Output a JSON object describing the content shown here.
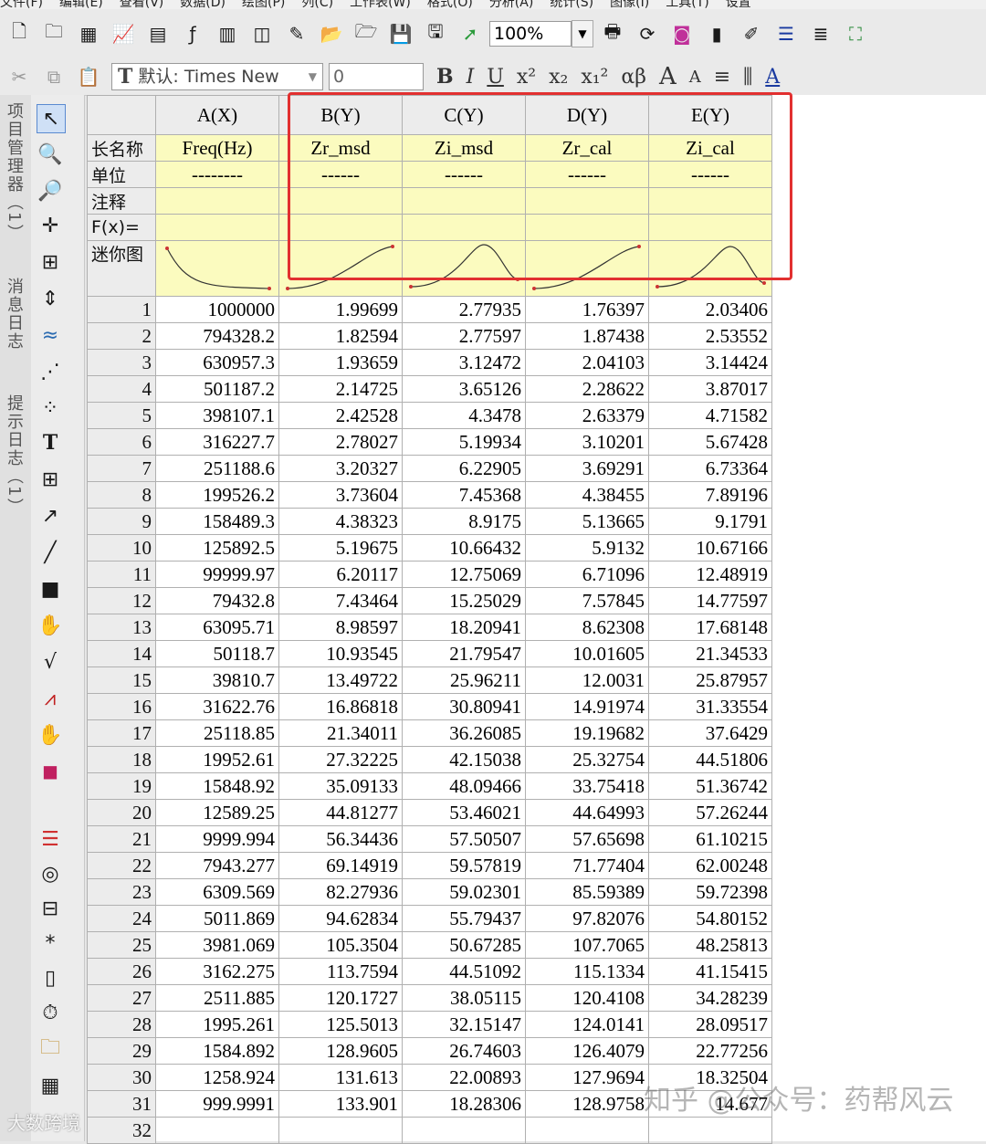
{
  "menu": [
    "文件(F)",
    "编辑(E)",
    "查看(V)",
    "数据(D)",
    "绘图(P)",
    "列(C)",
    "工作表(W)",
    "格式(O)",
    "分析(A)",
    "统计(S)",
    "图像(I)",
    "工具(T)",
    "设置"
  ],
  "toolbar1": {
    "zoom": "100%",
    "icons": [
      "new-project-icon",
      "new-folder-icon",
      "new-workbook-icon",
      "new-graph-icon",
      "new-matrix-icon",
      "new-function-icon",
      "new-excel-icon",
      "new-layout-icon",
      "new-notes-icon",
      "open-icon",
      "open-template-icon",
      "save-icon",
      "save-template-icon",
      "import-wizard-icon",
      "print-icon",
      "refresh-icon",
      "code-builder-icon",
      "film-icon",
      "notes-icon",
      "results-icon",
      "layers-icon",
      "project-explorer-icon"
    ]
  },
  "toolbar2": {
    "font_name": "默认: Times New",
    "font_size": "0",
    "bold": "B",
    "italic": "I",
    "underline": "U",
    "superscript": "x²",
    "subscript": "x₂",
    "supsub": "x₁²",
    "greek": "αβ",
    "bigger": "A",
    "smaller": "A"
  },
  "side_tabs": [
    "项目管理器（1）",
    "消息日志",
    "提示日志（1）"
  ],
  "tools": [
    "pointer-icon",
    "zoom-in-icon",
    "zoom-out-icon",
    "data-reader-icon",
    "screen-reader-icon",
    "scale-icon",
    "data-selector-icon",
    "region-selector-icon",
    "scatter-icon",
    "text-tool-icon",
    "layer-icon",
    "arrow-tool-icon",
    "line-tool-icon",
    "rect-tool-icon",
    "hand-icon",
    "equation-icon",
    "graph-icon",
    "mask-icon",
    "color-icon",
    "color-bars-icon",
    "circle-icon",
    "align-icon",
    "star-icon",
    "ruler-icon",
    "clock-icon",
    "folder-icon",
    "grid-icon"
  ],
  "sheet": {
    "columns": [
      "A(X)",
      "B(Y)",
      "C(Y)",
      "D(Y)",
      "E(Y)"
    ],
    "meta_labels": {
      "long_name": "长名称",
      "units": "单位",
      "comments": "注释",
      "formula": "F(x)=",
      "sparklines": "迷你图"
    },
    "long_names": [
      "Freq(Hz)",
      "Zr_msd",
      "Zi_msd",
      "Zr_cal",
      "Zi_cal"
    ],
    "units": [
      "--------",
      "------",
      "------",
      "------",
      "------"
    ],
    "rows": [
      [
        "1",
        "1000000",
        "1.99699",
        "2.77935",
        "1.76397",
        "2.03406"
      ],
      [
        "2",
        "794328.2",
        "1.82594",
        "2.77597",
        "1.87438",
        "2.53552"
      ],
      [
        "3",
        "630957.3",
        "1.93659",
        "3.12472",
        "2.04103",
        "3.14424"
      ],
      [
        "4",
        "501187.2",
        "2.14725",
        "3.65126",
        "2.28622",
        "3.87017"
      ],
      [
        "5",
        "398107.1",
        "2.42528",
        "4.3478",
        "2.63379",
        "4.71582"
      ],
      [
        "6",
        "316227.7",
        "2.78027",
        "5.19934",
        "3.10201",
        "5.67428"
      ],
      [
        "7",
        "251188.6",
        "3.20327",
        "6.22905",
        "3.69291",
        "6.73364"
      ],
      [
        "8",
        "199526.2",
        "3.73604",
        "7.45368",
        "4.38455",
        "7.89196"
      ],
      [
        "9",
        "158489.3",
        "4.38323",
        "8.9175",
        "5.13665",
        "9.1791"
      ],
      [
        "10",
        "125892.5",
        "5.19675",
        "10.66432",
        "5.9132",
        "10.67166"
      ],
      [
        "11",
        "99999.97",
        "6.20117",
        "12.75069",
        "6.71096",
        "12.48919"
      ],
      [
        "12",
        "79432.8",
        "7.43464",
        "15.25029",
        "7.57845",
        "14.77597"
      ],
      [
        "13",
        "63095.71",
        "8.98597",
        "18.20941",
        "8.62308",
        "17.68148"
      ],
      [
        "14",
        "50118.7",
        "10.93545",
        "21.79547",
        "10.01605",
        "21.34533"
      ],
      [
        "15",
        "39810.7",
        "13.49722",
        "25.96211",
        "12.0031",
        "25.87957"
      ],
      [
        "16",
        "31622.76",
        "16.86818",
        "30.80941",
        "14.91974",
        "31.33554"
      ],
      [
        "17",
        "25118.85",
        "21.34011",
        "36.26085",
        "19.19682",
        "37.6429"
      ],
      [
        "18",
        "19952.61",
        "27.32225",
        "42.15038",
        "25.32754",
        "44.51806"
      ],
      [
        "19",
        "15848.92",
        "35.09133",
        "48.09466",
        "33.75418",
        "51.36742"
      ],
      [
        "20",
        "12589.25",
        "44.81277",
        "53.46021",
        "44.64993",
        "57.26244"
      ],
      [
        "21",
        "9999.994",
        "56.34436",
        "57.50507",
        "57.65698",
        "61.10215"
      ],
      [
        "22",
        "7943.277",
        "69.14919",
        "59.57819",
        "71.77404",
        "62.00248"
      ],
      [
        "23",
        "6309.569",
        "82.27936",
        "59.02301",
        "85.59389",
        "59.72398"
      ],
      [
        "24",
        "5011.869",
        "94.62834",
        "55.79437",
        "97.82076",
        "54.80152"
      ],
      [
        "25",
        "3981.069",
        "105.3504",
        "50.67285",
        "107.7065",
        "48.25813"
      ],
      [
        "26",
        "3162.275",
        "113.7594",
        "44.51092",
        "115.1334",
        "41.15415"
      ],
      [
        "27",
        "2511.885",
        "120.1727",
        "38.05115",
        "120.4108",
        "34.28239"
      ],
      [
        "28",
        "1995.261",
        "125.5013",
        "32.15147",
        "124.0141",
        "28.09517"
      ],
      [
        "29",
        "1584.892",
        "128.9605",
        "26.74603",
        "126.4079",
        "22.77256"
      ],
      [
        "30",
        "1258.924",
        "131.613",
        "22.00893",
        "127.9694",
        "18.32504"
      ],
      [
        "31",
        "999.9991",
        "133.901",
        "18.28306",
        "128.9758",
        "14.677"
      ],
      [
        "32",
        "",
        "",
        "",
        "",
        ""
      ]
    ]
  },
  "watermark": "知乎 @公众号：药帮风云",
  "watermark2": "大数跨境",
  "colors": {
    "meta_bg": "#fbfbbf",
    "header_bg": "#ececec",
    "highlight": "#e23030"
  }
}
